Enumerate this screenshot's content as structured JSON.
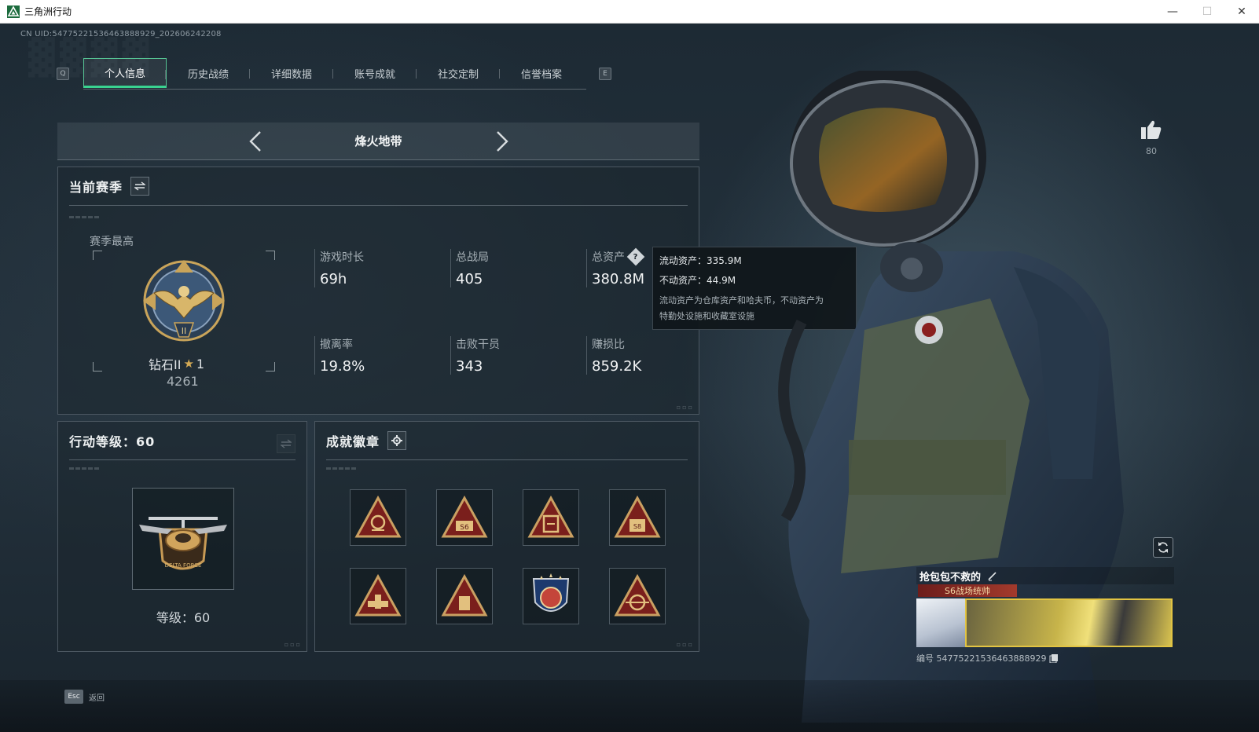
{
  "window": {
    "title": "三角洲行动",
    "controls": {
      "minimize": "—",
      "maximize": "☐",
      "close": "✕"
    }
  },
  "uid_line": "CN UID:5477522153646388892​9_202606242208",
  "tabs": {
    "left_key": "Q",
    "right_key": "E",
    "items": [
      {
        "label": "个人信息",
        "active": true
      },
      {
        "label": "历史战绩",
        "active": false
      },
      {
        "label": "详细数据",
        "active": false
      },
      {
        "label": "账号成就",
        "active": false
      },
      {
        "label": "社交定制",
        "active": false
      },
      {
        "label": "信誉档案",
        "active": false
      }
    ]
  },
  "mode": {
    "title": "烽火地带"
  },
  "season": {
    "title": "当前赛季",
    "best_label": "赛季最高",
    "rank_name": "钻石II",
    "rank_stars": "1",
    "rank_score": "4261",
    "stats": [
      {
        "label": "游戏时长",
        "value": "69h"
      },
      {
        "label": "总战局",
        "value": "405"
      },
      {
        "label": "总资产",
        "value": "380.8M",
        "help": "?"
      },
      {
        "label": "撤离率",
        "value": "19.8%"
      },
      {
        "label": "击败干员",
        "value": "343"
      },
      {
        "label": "赚损比",
        "value": "859.2K"
      }
    ]
  },
  "tooltip": {
    "liquid": "流动资产：335.9M",
    "fixed": "不动资产：44.9M",
    "note_line1": "流动资产为仓库资产和哈夫币，不动资产为",
    "note_line2": "特勤处设施和收藏室设施"
  },
  "level": {
    "title": "行动等级：60",
    "text": "等级：60"
  },
  "achievements": {
    "title": "成就徽章"
  },
  "like": {
    "count": "80"
  },
  "player_card": {
    "name": "抢包包不救的",
    "title": "S6战场统帅",
    "id_line": "编号 5477522153646388892​9"
  },
  "footer": {
    "esc_key": "Esc",
    "esc_label": "返回"
  },
  "colors": {
    "accent": "#39d390",
    "gold": "#d4aa55",
    "badge_red": "#7a1f1c"
  }
}
